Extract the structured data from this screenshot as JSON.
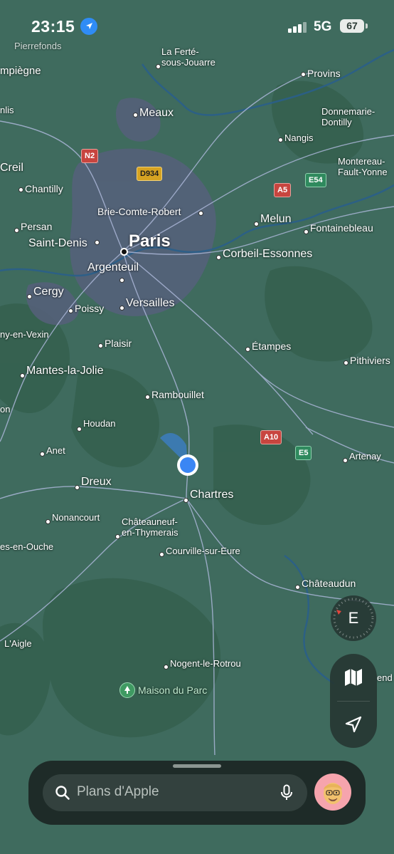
{
  "status_bar": {
    "time": "23:15",
    "network": "5G",
    "battery": "67"
  },
  "map": {
    "labels": {
      "pierrefonds": "Pierrefonds",
      "la_ferte": "La Ferté-\nsous-Jouarre",
      "compiegne": "mpiègne",
      "provins": "Provins",
      "senlis": "nlis",
      "meaux": "Meaux",
      "donnemarie": "Donnemarie-\nDontilly",
      "nangis": "Nangis",
      "creil": "Creil",
      "montereau": "Montereau-\nFault-Yonne",
      "chantilly": "Chantilly",
      "brie": "Brie-Comte-Robert",
      "melun": "Melun",
      "persan": "Persan",
      "fontainebleau": "Fontainebleau",
      "saint_denis": "Saint-Denis",
      "paris": "Paris",
      "corbeil": "Corbeil-Essonnes",
      "argenteuil": "Argenteuil",
      "cergy": "Cergy",
      "poissy": "Poissy",
      "versailles": "Versailles",
      "vexin": "ny-en-Vexin",
      "plaisir": "Plaisir",
      "etampes": "Étampes",
      "pithiviers": "Pithiviers",
      "mantes": "Mantes-la-Jolie",
      "rambouillet": "Rambouillet",
      "on": "on",
      "houdan": "Houdan",
      "anet": "Anet",
      "artenay": "Artenay",
      "dreux": "Dreux",
      "chartres": "Chartres",
      "nonancourt": "Nonancourt",
      "chateauneuf": "Châteauneuf-\nen-Thymerais",
      "ouche": "es-en-Ouche",
      "courville": "Courville-sur-Eure",
      "chateaudun": "Châteaudun",
      "laigle": "L'Aigle",
      "nogent": "Nogent-le-Rotrou",
      "maison": "Maison du Parc",
      "vendome_partial": "end"
    },
    "shields": {
      "n2": "N2",
      "d934": "D934",
      "a5": "A5",
      "e54": "E54",
      "a10": "A10",
      "e5": "E5"
    }
  },
  "compass": {
    "heading": "E"
  },
  "search": {
    "placeholder": "Plans d'Apple"
  },
  "colors": {
    "land": "#3f6b5e",
    "urban": "#5a5f7a",
    "water": "#2a5f8a",
    "roads": "#a9b5d6",
    "location": "#3a86f4"
  }
}
